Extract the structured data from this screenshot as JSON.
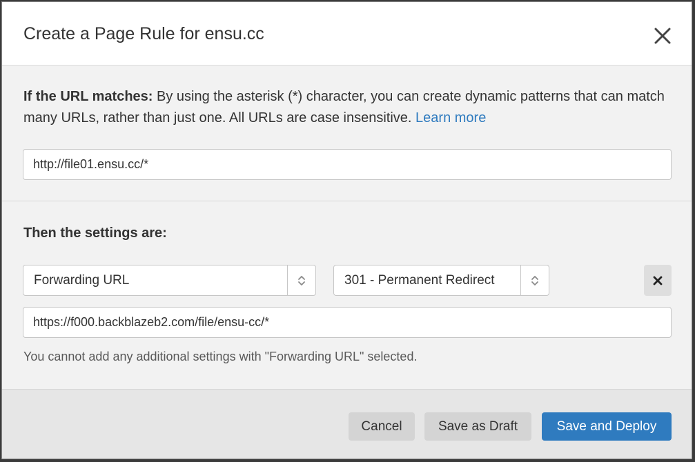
{
  "dialog": {
    "title": "Create a Page Rule for ensu.cc",
    "close_icon": "close-icon"
  },
  "url_section": {
    "label_bold": "If the URL matches:",
    "description": " By using the asterisk (*) character, you can create dynamic patterns that can match many URLs, rather than just one. All URLs are case insensitive. ",
    "learn_more": "Learn more",
    "url_value": "http://file01.ensu.cc/*"
  },
  "settings_section": {
    "heading": "Then the settings are:",
    "setting_select": "Forwarding URL",
    "status_select": "301 - Permanent Redirect",
    "remove_icon": "x-icon",
    "destination_value": "https://f000.backblazeb2.com/file/ensu-cc/*",
    "note": "You cannot add any additional settings with \"Forwarding URL\" selected."
  },
  "footer": {
    "cancel_label": "Cancel",
    "draft_label": "Save as Draft",
    "deploy_label": "Save and Deploy"
  },
  "colors": {
    "accent": "#2f7bbf",
    "link": "#2f7bbf",
    "footer_bg": "#e6e6e6",
    "body_bg": "#f2f2f2"
  }
}
